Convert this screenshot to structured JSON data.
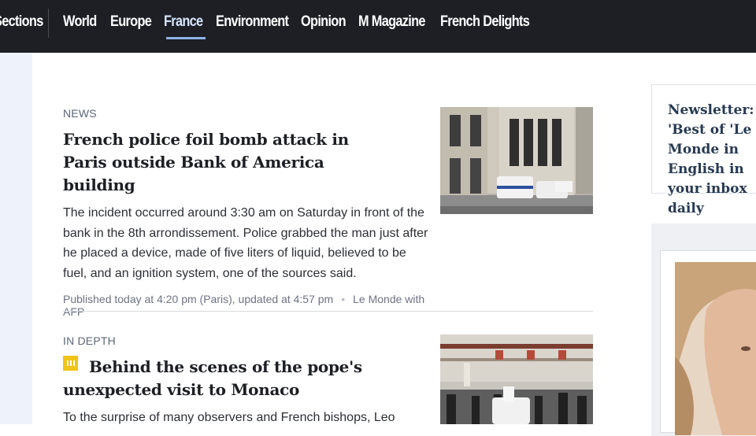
{
  "nav": {
    "sections_label": "Sections",
    "items": [
      {
        "label": "World"
      },
      {
        "label": "Europe"
      },
      {
        "label": "France"
      },
      {
        "label": "Environment"
      },
      {
        "label": "Opinion"
      },
      {
        "label": "M Magazine"
      },
      {
        "label": "French Delights"
      }
    ],
    "active": "France"
  },
  "articles": [
    {
      "kicker": "NEWS",
      "headline": "French police foil bomb attack in Paris outside Bank of America building",
      "summary": "The incident occurred around 3:30 am on Saturday in front of the bank in the 8th arrondissement. Police grabbed the man just after he placed a device, made of five liters of liquid, believed to be fuel, and an ignition system, one of the sources said.",
      "published": "Published today at 4:20 pm (Paris), updated at 4:57 pm",
      "source": "Le Monde with AFP"
    },
    {
      "kicker": "IN DEPTH",
      "badge_icon": "subscriber-badge-icon",
      "headline": "Behind the scenes of the pope's unexpected visit to Monaco",
      "summary": "To the surprise of many observers and French bishops, Leo"
    }
  ],
  "sidebar": {
    "newsletter": "Newsletter: 'Best of 'Le Monde in English in your inbox daily"
  },
  "colors": {
    "nav_background": "#1d1f24",
    "active_underline": "#8fb3e8",
    "kicker": "#5c6679",
    "badge": "#f0c419"
  }
}
